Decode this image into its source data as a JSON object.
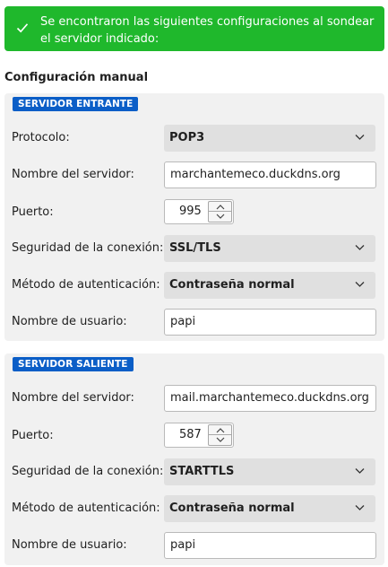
{
  "banner": {
    "message": "Se encontraron las siguientes configuraciones al sondear el servidor indicado:"
  },
  "section_title": "Configuración manual",
  "incoming": {
    "title": "SERVIDOR ENTRANTE",
    "protocol_label": "Protocolo:",
    "protocol_value": "POP3",
    "server_label": "Nombre del servidor:",
    "server_value": "marchantemeco.duckdns.org",
    "port_label": "Puerto:",
    "port_value": "995",
    "security_label": "Seguridad de la conexión:",
    "security_value": "SSL/TLS",
    "auth_label": "Método de autenticación:",
    "auth_value": "Contraseña normal",
    "user_label": "Nombre de usuario:",
    "user_value": "papi"
  },
  "outgoing": {
    "title": "SERVIDOR SALIENTE",
    "server_label": "Nombre del servidor:",
    "server_value": "mail.marchantemeco.duckdns.org",
    "port_label": "Puerto:",
    "port_value": "587",
    "security_label": "Seguridad de la conexión:",
    "security_value": "STARTTLS",
    "auth_label": "Método de autenticación:",
    "auth_value": "Contraseña normal",
    "user_label": "Nombre de usuario:",
    "user_value": "papi"
  },
  "colors": {
    "banner": "#1fb82c",
    "group_label": "#0b5ec7",
    "group_bg": "#f1f1f1",
    "select_bg": "#e0e0e0"
  }
}
